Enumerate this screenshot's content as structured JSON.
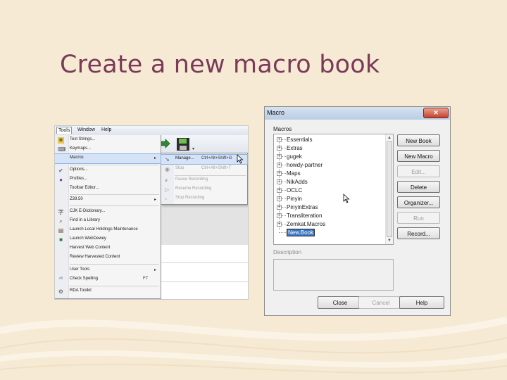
{
  "slide": {
    "title": "Create a new macro book"
  },
  "colors": {
    "background": "#f6ead4",
    "title": "#7a3a58",
    "highlight": "#d5e3f7",
    "selection": "#3a75c4"
  },
  "tools_menu_screenshot": {
    "menubar": [
      "Tools",
      "Window",
      "Help"
    ],
    "tools_menu": {
      "items": [
        {
          "label": "Text Strings...",
          "icon": "text-strings-icon"
        },
        {
          "label": "Keymaps...",
          "icon": "keymaps-icon"
        },
        {
          "label": "Macros",
          "icon": "",
          "submenu": true,
          "highlighted": true
        },
        {
          "label": "Options...",
          "icon": "options-icon"
        },
        {
          "label": "Profiles...",
          "icon": "profiles-icon"
        },
        {
          "label": "Toolbar Editor...",
          "icon": ""
        },
        {
          "label": "Z39.50",
          "icon": "",
          "submenu": true
        },
        {
          "label": "CJK E-Dictionary...",
          "icon": "dictionary-icon"
        },
        {
          "label": "Find in a Library",
          "icon": "find-library-icon"
        },
        {
          "label": "Launch Local Holdings Maintenance",
          "icon": "holdings-icon"
        },
        {
          "label": "Launch WebDewey",
          "icon": "webdewey-icon"
        },
        {
          "label": "Harvest Web Content",
          "icon": ""
        },
        {
          "label": "Review Harvested Content",
          "icon": ""
        },
        {
          "label": "User Tools",
          "icon": "",
          "submenu": true
        },
        {
          "label": "Check Spelling",
          "icon": "spelling-icon",
          "shortcut": "F7"
        },
        {
          "label": "RDA Toolkit",
          "icon": "rda-icon"
        }
      ]
    },
    "macros_submenu": {
      "items": [
        {
          "label": "Manage...",
          "shortcut": "Ctrl+Alt+Shift+G",
          "enabled": true,
          "highlighted": true
        },
        {
          "label": "Stop",
          "shortcut": "Ctrl+Alt+Shift+T",
          "enabled": false
        },
        {
          "label": "Pause Recording",
          "shortcut": "",
          "enabled": false
        },
        {
          "label": "Resume Recording",
          "shortcut": "",
          "enabled": false
        },
        {
          "label": "Stop Recording",
          "shortcut": "",
          "enabled": false
        }
      ]
    }
  },
  "macro_dialog": {
    "title": "Macro",
    "close_glyph": "✕",
    "macros_label": "Macros",
    "books": [
      "Essentials",
      "Extras",
      "gugek",
      "howdy-partner",
      "Maps",
      "NikAdds",
      "OCLC",
      "Pinyin",
      "PinyinExtras",
      "Transliteration",
      "Zemkat.Macros"
    ],
    "new_book_edit_value": "New.Book",
    "description_label": "Description",
    "description_value": "",
    "side_buttons": [
      {
        "label": "New Book",
        "enabled": true
      },
      {
        "label": "New Macro",
        "enabled": true
      },
      {
        "label": "Edit...",
        "enabled": false
      },
      {
        "label": "Delete",
        "enabled": true
      },
      {
        "label": "Organizer...",
        "enabled": true
      },
      {
        "label": "Run",
        "enabled": false
      },
      {
        "label": "Record...",
        "enabled": true
      }
    ],
    "bottom_buttons": [
      {
        "label": "Close",
        "enabled": true
      },
      {
        "label": "Cancel",
        "enabled": false
      },
      {
        "label": "Help",
        "enabled": true
      }
    ]
  }
}
